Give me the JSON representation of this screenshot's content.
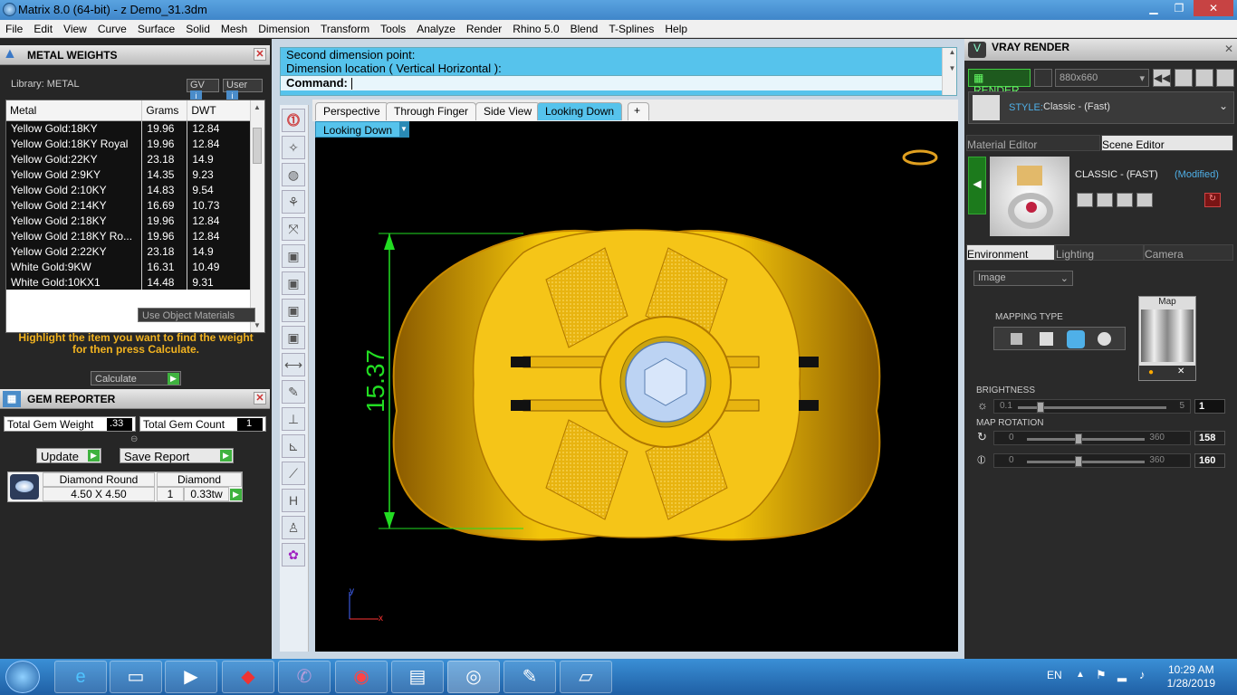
{
  "window": {
    "title": "Matrix 8.0 (64-bit) - z Demo_31.3dm",
    "min": "▁",
    "max": "❐",
    "close": "✕"
  },
  "menu": [
    "File",
    "Edit",
    "View",
    "Curve",
    "Surface",
    "Solid",
    "Mesh",
    "Dimension",
    "Transform",
    "Tools",
    "Analyze",
    "Render",
    "Rhino 5.0",
    "Blend",
    "T-Splines",
    "Help"
  ],
  "metal_weights": {
    "title": "METAL WEIGHTS",
    "library_label": "Library: METAL",
    "gv_label": "GV",
    "user_label": "User",
    "columns": [
      "Metal",
      "Grams",
      "DWT"
    ],
    "rows": [
      [
        "Yellow Gold:18KY",
        "19.96",
        "12.84"
      ],
      [
        "Yellow Gold:18KY Royal",
        "19.96",
        "12.84"
      ],
      [
        "Yellow Gold:22KY",
        "23.18",
        "14.9"
      ],
      [
        "Yellow Gold 2:9KY",
        "14.35",
        "9.23"
      ],
      [
        "Yellow Gold 2:10KY",
        "14.83",
        "9.54"
      ],
      [
        "Yellow Gold 2:14KY",
        "16.69",
        "10.73"
      ],
      [
        "Yellow Gold 2:18KY",
        "19.96",
        "12.84"
      ],
      [
        "Yellow Gold 2:18KY Ro...",
        "19.96",
        "12.84"
      ],
      [
        "Yellow Gold 2:22KY",
        "23.18",
        "14.9"
      ],
      [
        "White Gold:9KW",
        "16.31",
        "10.49"
      ],
      [
        "White Gold:10KX1",
        "14.48",
        "9.31"
      ]
    ],
    "use_object_materials": "Use Object Materials",
    "hint": "Highlight the item you want to find the weight for then press Calculate.",
    "calculate": "Calculate"
  },
  "gem_reporter": {
    "title": "GEM REPORTER",
    "total_weight_label": "Total Gem Weight",
    "total_weight_value": ".33",
    "total_count_label": "Total Gem Count",
    "total_count_value": "1",
    "update": "Update",
    "save_report": "Save Report",
    "gem_name": "Diamond Round",
    "gem_size": "4.50 X 4.50",
    "gem_type": "Diamond",
    "gem_qty": "1",
    "gem_weight": "0.33tw"
  },
  "command": {
    "line1": "Second dimension point:",
    "line2": "Dimension location ( Vertical  Horizontal ):",
    "prompt": "Command:"
  },
  "viewport": {
    "tabs": [
      "Perspective",
      "Through Finger",
      "Side View",
      "Looking Down"
    ],
    "add_tab": "+",
    "active_view": "Looking Down",
    "dimension": "15.37",
    "axis_y": "y",
    "axis_x": "x"
  },
  "vray": {
    "title": "VRAY RENDER",
    "render_button": "RENDER",
    "resolution": "880x660",
    "style_label": "STYLE:",
    "style_value": "Classic - (Fast)",
    "tab_material": "Material Editor",
    "tab_scene": "Scene Editor",
    "scene_name": "CLASSIC - (FAST)",
    "scene_modified": "(Modified)",
    "tab_environment": "Environment",
    "tab_lighting": "Lighting",
    "tab_camera": "Camera",
    "env_type": "Image",
    "mapping_type": "MAPPING TYPE",
    "map_label": "Map",
    "brightness_label": "BRIGHTNESS",
    "brightness_min": "0.1",
    "brightness_max": "5",
    "brightness_value": "1",
    "brightness_level": 0.15,
    "rotation_label": "MAP ROTATION",
    "rot1_min": "0",
    "rot1_max": "360",
    "rot1_value": "158",
    "rot1_level": 0.44,
    "rot2_min": "0",
    "rot2_max": "360",
    "rot2_value": "160",
    "rot2_level": 0.44
  },
  "taskbar": {
    "lang": "EN",
    "time": "10:29 AM",
    "date": "1/28/2019"
  },
  "colors": {
    "accent": "#56c3ec",
    "gold": "#f5c518",
    "dimension": "#22dd22"
  }
}
